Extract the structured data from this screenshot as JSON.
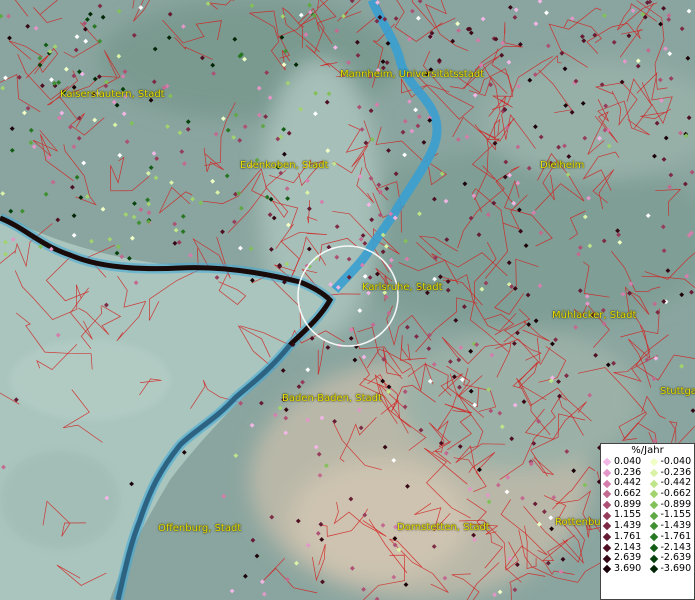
{
  "legend": {
    "title": "%/Jahr",
    "positive": [
      {
        "label": "0.040",
        "color": "#f2b6e6"
      },
      {
        "label": "0.236",
        "color": "#e397c8"
      },
      {
        "label": "0.442",
        "color": "#d57ead"
      },
      {
        "label": "0.662",
        "color": "#c36a90"
      },
      {
        "label": "0.899",
        "color": "#ad5274"
      },
      {
        "label": "1.155",
        "color": "#973d5c"
      },
      {
        "label": "1.439",
        "color": "#7e2b46"
      },
      {
        "label": "1.761",
        "color": "#661c33"
      },
      {
        "label": "2.143",
        "color": "#4e0f22"
      },
      {
        "label": "2.639",
        "color": "#360714"
      },
      {
        "label": "3.690",
        "color": "#1a0208"
      }
    ],
    "negative": [
      {
        "label": "-0.040",
        "color": "#f0ffc6"
      },
      {
        "label": "-0.236",
        "color": "#d9f2a8"
      },
      {
        "label": "-0.442",
        "color": "#bfe58b"
      },
      {
        "label": "-0.662",
        "color": "#a2d36f"
      },
      {
        "label": "-0.899",
        "color": "#82c058"
      },
      {
        "label": "-1.155",
        "color": "#5fa843"
      },
      {
        "label": "-1.439",
        "color": "#3f9031"
      },
      {
        "label": "-1.761",
        "color": "#267622"
      },
      {
        "label": "-2.143",
        "color": "#125c16"
      },
      {
        "label": "-2.639",
        "color": "#06420c"
      },
      {
        "label": "-3.690",
        "color": "#012606"
      }
    ]
  },
  "cities": [
    {
      "id": "kaiserslautern",
      "label": "Kaiserslautern, Stadt"
    },
    {
      "id": "mannheim",
      "label": "Mannheim, Universitätsstadt"
    },
    {
      "id": "edenkoben",
      "label": "Edenkoben, Stadt"
    },
    {
      "id": "dielheim",
      "label": "Dielheim"
    },
    {
      "id": "karlsruhe",
      "label": "Karlsruhe, Stadt"
    },
    {
      "id": "muehlacker",
      "label": "Mühlacker, Stadt"
    },
    {
      "id": "stuttgart",
      "label": "Stuttga"
    },
    {
      "id": "baden-baden",
      "label": "Baden-Baden, Stadt"
    },
    {
      "id": "offenburg",
      "label": "Offenburg, Stadt"
    },
    {
      "id": "dornstetten",
      "label": "Dornstetten, Stadt"
    },
    {
      "id": "rottenburg",
      "label": "Rottenbu"
    }
  ],
  "colors": {
    "terrain": "#8fa9a3",
    "plain": "#a9c5bd",
    "river": "#3a9fd0",
    "border": "#d41c1c",
    "country_border": "#1a0b0b",
    "city_label": "#e8e000",
    "highlight_circle": "#ffffff"
  }
}
